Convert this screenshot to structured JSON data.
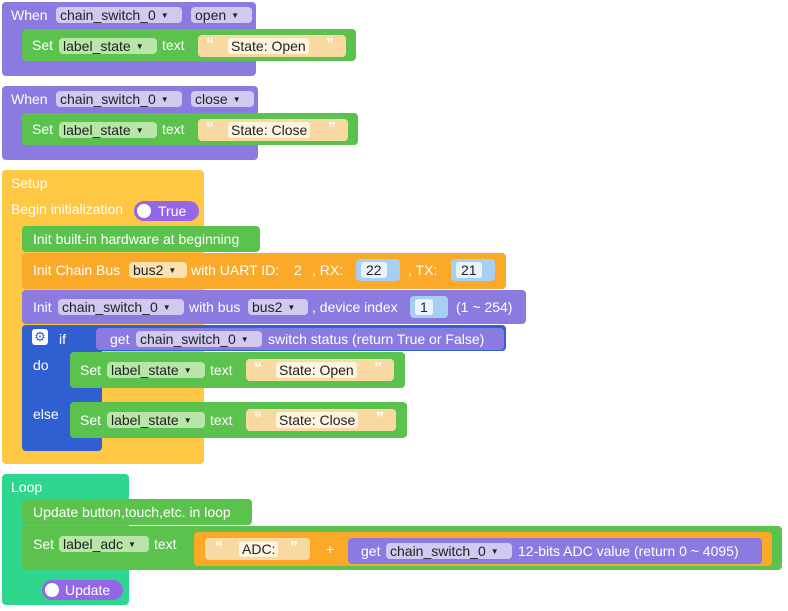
{
  "colors": {
    "event_purple": "#8b7be0",
    "set_green": "#5bc24e",
    "setup_yellow": "#ffc844",
    "init_orange": "#fba928",
    "logic_blue": "#2f5fd0",
    "loop_green": "#2fd68d",
    "toggle_purple": "#9466e8"
  },
  "events": [
    {
      "when_label": "When",
      "device": "chain_switch_0",
      "event": "open",
      "set_label": "Set",
      "target": "label_state",
      "text_label": "text",
      "value": "State: Open"
    },
    {
      "when_label": "When",
      "device": "chain_switch_0",
      "event": "close",
      "set_label": "Set",
      "target": "label_state",
      "text_label": "text",
      "value": "State: Close"
    }
  ],
  "setup": {
    "title": "Setup",
    "begin_init_label": "Begin initialization",
    "begin_init_value": "True",
    "init_builtin": "Init built-in hardware at beginning",
    "chain_bus": {
      "label": "Init Chain Bus",
      "bus": "bus2",
      "uart_label": "with UART ID:",
      "uart_id": "2",
      "rx_label": ", RX:",
      "rx": "22",
      "tx_label": ", TX:",
      "tx": "21"
    },
    "init_device": {
      "label": "Init",
      "device": "chain_switch_0",
      "with_bus_label": "with bus",
      "bus": "bus2",
      "index_label": ", device index",
      "index": "1",
      "range": "(1 ~ 254)"
    },
    "if_block": {
      "if_label": "if",
      "do_label": "do",
      "else_label": "else",
      "get_label": "get",
      "device": "chain_switch_0",
      "condition": "switch status (return True or False)",
      "do_set": {
        "set_label": "Set",
        "target": "label_state",
        "text_label": "text",
        "value": "State: Open"
      },
      "else_set": {
        "set_label": "Set",
        "target": "label_state",
        "text_label": "text",
        "value": "State: Close"
      }
    }
  },
  "loop": {
    "title": "Loop",
    "update_label": "Update button,touch,etc. in loop",
    "set_label": "Set",
    "target": "label_adc",
    "text_label": "text",
    "prefix": "ADC:",
    "plus": "+",
    "get_label": "get",
    "device": "chain_switch_0",
    "adc_desc": "12-bits ADC value (return 0 ~ 4095)",
    "update_toggle": "Update"
  },
  "icons": {
    "quote_open": "“",
    "quote_close": "”",
    "caret": "▼",
    "gear": "⚙"
  }
}
